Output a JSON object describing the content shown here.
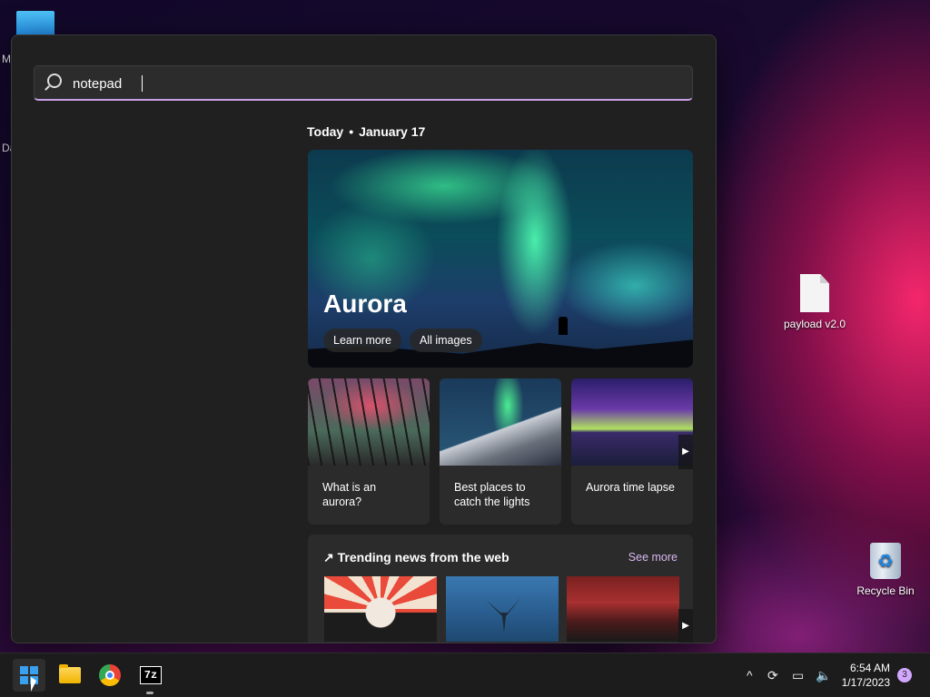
{
  "desktop": {
    "cut_labels": [
      "M",
      "Da"
    ],
    "icons": [
      {
        "label": "payload v2.0",
        "icon": "text-file-icon"
      },
      {
        "label": "Recycle Bin",
        "icon": "recycle-bin-icon"
      }
    ]
  },
  "search": {
    "value": "notepad",
    "placeholder": ""
  },
  "today": {
    "label": "Today",
    "date": "January 17"
  },
  "hero": {
    "title": "Aurora",
    "learn_more": "Learn more",
    "all_images": "All images"
  },
  "cards": [
    {
      "caption": "What is an aurora?"
    },
    {
      "caption": "Best places to catch the lights"
    },
    {
      "caption": "Aurora time lapse"
    }
  ],
  "news": {
    "title": "Trending news from the web",
    "see_more": "See more"
  },
  "taskbar": {
    "apps": [
      "start-icon",
      "file-explorer-icon",
      "chrome-icon",
      "7zip-icon"
    ],
    "sevenzip_label": "7z",
    "time": "6:54 AM",
    "date": "1/17/2023",
    "notification_count": "3"
  },
  "colors": {
    "accent": "#c7a0e8",
    "panel_bg": "#202020",
    "card_bg": "#2b2b2b",
    "taskbar_bg": "#1c1c1c"
  }
}
